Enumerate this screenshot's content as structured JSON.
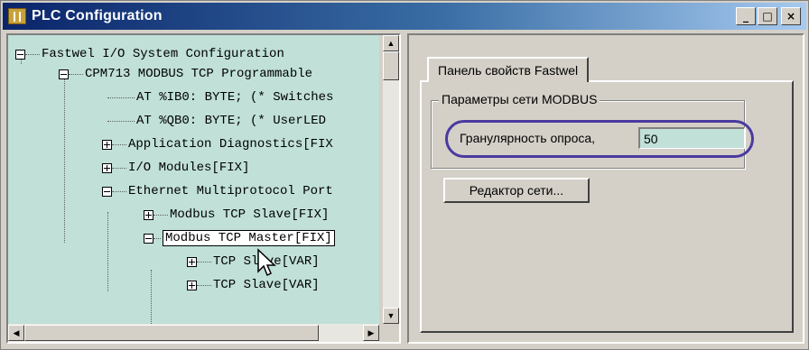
{
  "window": {
    "title": "PLC Configuration",
    "controls": {
      "minimize": "_",
      "maximize": "□",
      "close": "×"
    }
  },
  "tree": {
    "items": [
      {
        "label": "Fastwel I/O System Configuration",
        "state": "expanded"
      },
      {
        "label": "CPM713 MODBUS TCP Programmable",
        "state": "expanded"
      },
      {
        "label": "AT %IB0: BYTE; (* Switches",
        "state": "leaf"
      },
      {
        "label": "AT %QB0: BYTE; (* UserLED",
        "state": "leaf"
      },
      {
        "label": "Application Diagnostics[FIX",
        "state": "collapsed"
      },
      {
        "label": "I/O Modules[FIX]",
        "state": "collapsed"
      },
      {
        "label": "Ethernet Multiprotocol Port",
        "state": "expanded"
      },
      {
        "label": "Modbus TCP Slave[FIX]",
        "state": "collapsed"
      },
      {
        "label": "Modbus TCP Master[FIX]",
        "state": "expanded",
        "selected": true
      },
      {
        "label": "TCP Slave[VAR]",
        "state": "collapsed"
      },
      {
        "label": "TCP Slave[VAR]",
        "state": "collapsed"
      }
    ]
  },
  "properties": {
    "tab_label": "Панель свойств Fastwel",
    "group_title": "Параметры сети MODBUS",
    "poll_granularity_label": "Гранулярность опроса,",
    "poll_granularity_value": "50",
    "network_editor_button": "Редактор сети..."
  },
  "colors": {
    "titlebar": "#0a246a",
    "tree_background": "#c0e0d8",
    "highlight": "#4a3aa0"
  }
}
